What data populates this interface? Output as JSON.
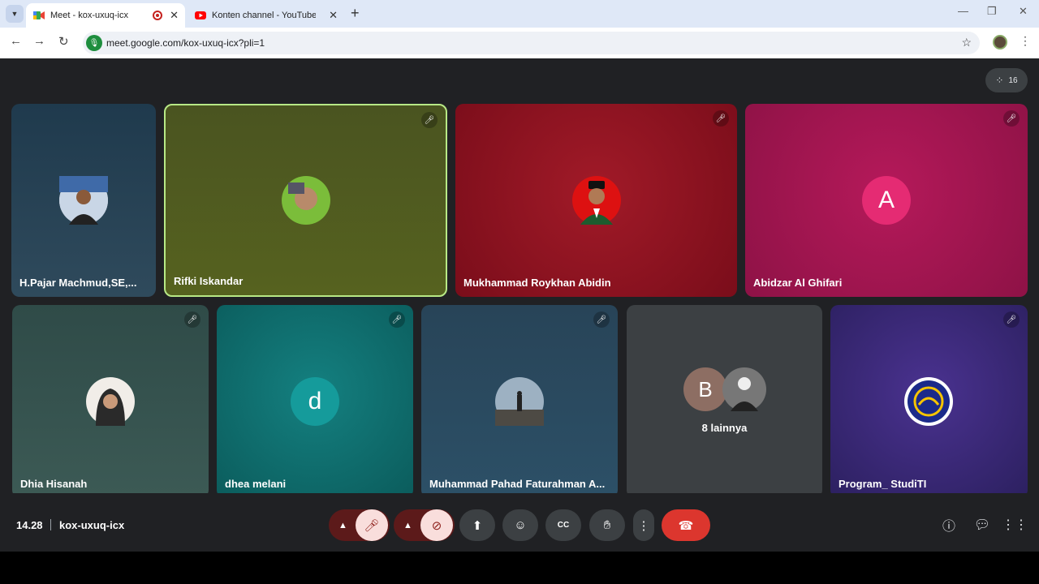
{
  "browser": {
    "tabs": [
      {
        "title": "Meet - kox-uxuq-icx",
        "icon": "google-meet-icon"
      },
      {
        "title": "Konten channel - YouTube Stud",
        "icon": "youtube-icon"
      }
    ],
    "url": "meet.google.com/kox-uxuq-icx?pli=1"
  },
  "meet": {
    "participant_count": "16",
    "tiles_row1": [
      {
        "name": "H.Pajar Machmud,SE,...",
        "bg": "#2f4a5c",
        "muted": false
      },
      {
        "name": "Rifki Iskandar",
        "bg": "#4f5a1e",
        "muted": true,
        "speaking": true
      },
      {
        "name": "Mukhammad Roykhan Abidin",
        "bg": "#8a1020",
        "muted": true
      },
      {
        "name": "Abidzar Al Ghifari",
        "bg": "#a0174e",
        "muted": true,
        "initial": "A"
      }
    ],
    "tiles_row2": [
      {
        "name": "Dhia Hisanah",
        "bg": "#3c5a55",
        "muted": true
      },
      {
        "name": "dhea melani",
        "bg": "#0f6f6f",
        "muted": true,
        "initial": "d"
      },
      {
        "name": "Muhammad Pahad Faturahman A...",
        "bg": "#2c5067",
        "muted": true
      },
      {
        "name": "8 lainnya",
        "bg": "#3c4043",
        "initial": "B"
      },
      {
        "name": "Program_ StudiTI",
        "bg": "#3a2a70",
        "muted": true
      }
    ],
    "clock": "14.28",
    "meeting_code": "kox-uxuq-icx"
  }
}
